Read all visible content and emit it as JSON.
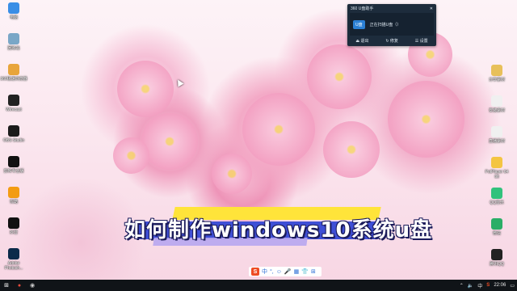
{
  "desktop": {
    "left_icons": [
      {
        "label": "电脑",
        "icon": "computer-icon",
        "color": "#3a8ee6"
      },
      {
        "label": "回收站",
        "icon": "recycle-bin-icon",
        "color": "#7aa7c7"
      },
      {
        "label": "360极速浏览器",
        "icon": "browser-icon",
        "color": "#e8a53b"
      },
      {
        "label": "Wirecast",
        "icon": "wirecast-icon",
        "color": "#222222"
      },
      {
        "label": "OBS Studio",
        "icon": "obs-icon",
        "color": "#1b1b1b"
      },
      {
        "label": "剪映专业版",
        "icon": "jianying-icon",
        "color": "#111111"
      },
      {
        "label": "优酷",
        "icon": "youku-icon",
        "color": "#f39c12"
      },
      {
        "label": "抖音",
        "icon": "douyin-icon",
        "color": "#111111"
      },
      {
        "label": "Adobe Photosh...",
        "icon": "photoshop-icon",
        "color": "#0b2a4a"
      }
    ],
    "right_icons": [
      {
        "label": "分享素材",
        "icon": "folder-icon",
        "color": "#e8c05a"
      },
      {
        "label": "安装素材",
        "icon": "folder-icon",
        "color": "#f0f0f0"
      },
      {
        "label": "直播素材",
        "icon": "folder-icon",
        "color": "#f0f0f0"
      },
      {
        "label": "PotPlayer 64 bit",
        "icon": "potplayer-icon",
        "color": "#f4c542"
      },
      {
        "label": "QQ音乐",
        "icon": "qq-music-icon",
        "color": "#31c27c"
      },
      {
        "label": "微信",
        "icon": "wechat-icon",
        "color": "#2aae67"
      },
      {
        "label": "腾讯QQ",
        "icon": "qq-icon",
        "color": "#222222"
      }
    ]
  },
  "popup": {
    "title": "360 U盘助手",
    "badge": "U盘",
    "status": "正在扫描U盘（）",
    "actions": [
      "退出",
      "修复",
      "设置"
    ]
  },
  "banner": {
    "text": "如何制作windows10系统u盘"
  },
  "ime": {
    "logo": "S",
    "items": [
      "中",
      "°,",
      "☺",
      "🎤",
      "▦",
      "👕",
      "⊞"
    ]
  },
  "taskbar": {
    "clock": "22:06",
    "tray_items": [
      "⌃",
      "🔈",
      "中",
      "S"
    ]
  },
  "colors": {
    "taskbar_bg": "#101418",
    "popup_bg": "#1d2c3c",
    "banner_blue": "#3f4fd6",
    "banner_yellow": "#ffe43a"
  }
}
